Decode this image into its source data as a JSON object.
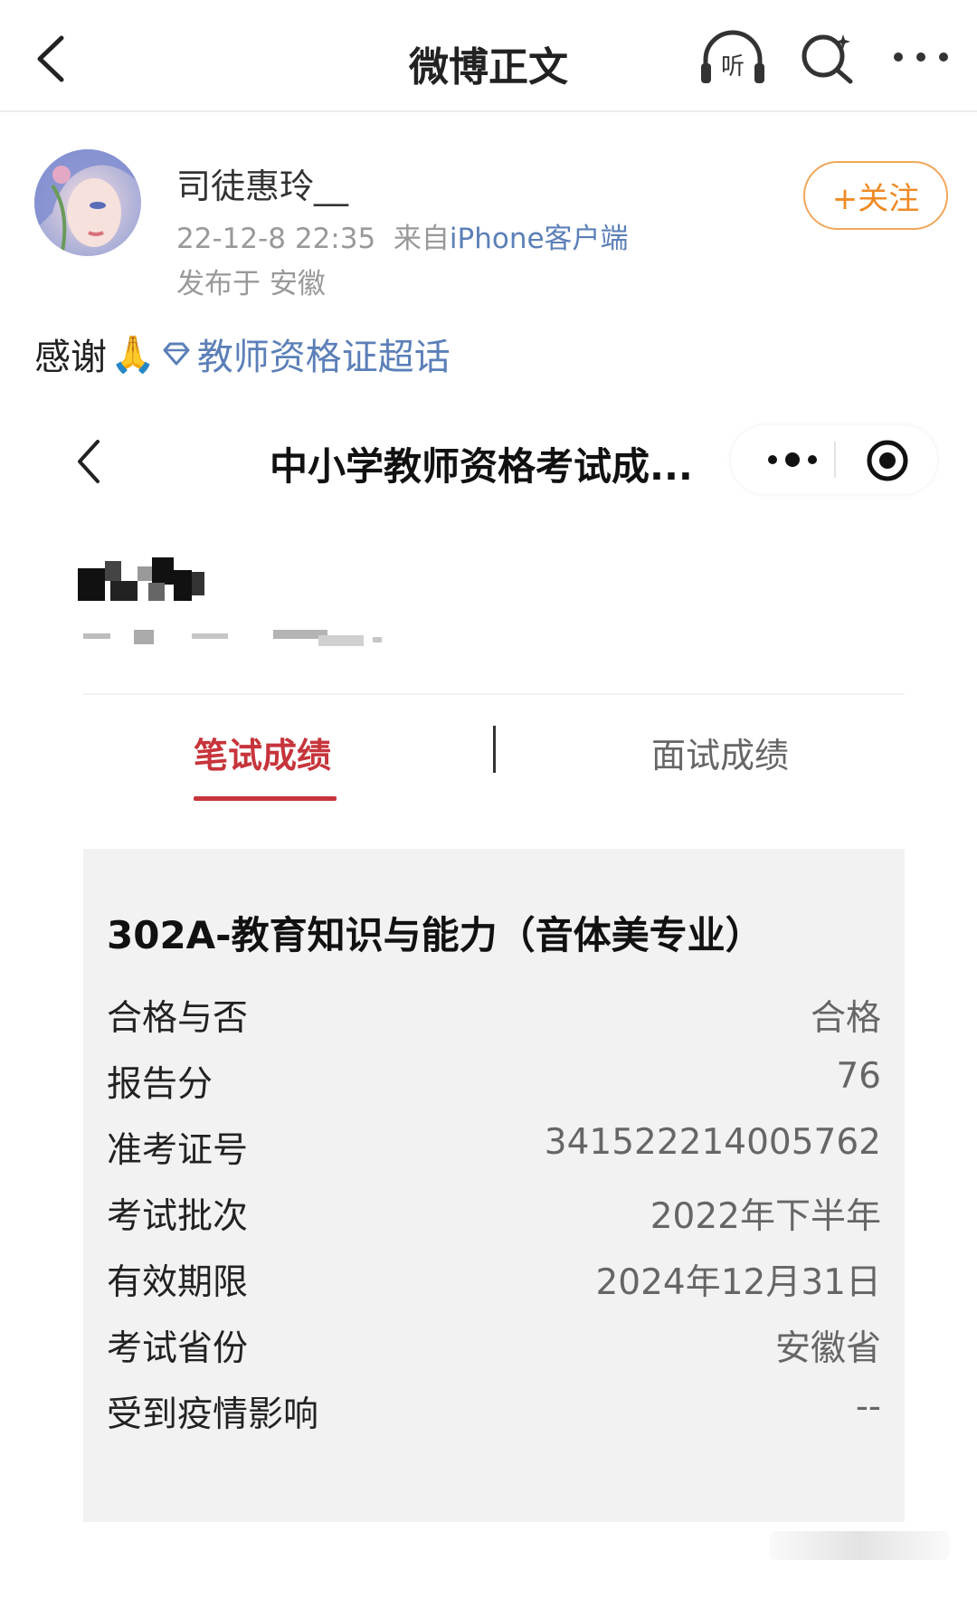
{
  "nav": {
    "title": "微博正文",
    "listen_icon": "listen-headphones-icon",
    "listen_label": "听",
    "search_icon": "search-icon",
    "more_icon": "more-icon"
  },
  "post": {
    "username": "司徒惠玲__",
    "time": "22-12-8 22:35",
    "source_prefix": "来自",
    "source": "iPhone客户端",
    "location": "发布于 安徽",
    "follow_label": "+关注",
    "text": "感谢",
    "emoji": "🙏",
    "topic": "教师资格证超话"
  },
  "embedded": {
    "title": "中小学教师资格考试成...",
    "tabs": [
      {
        "label": "笔试成绩",
        "active": true
      },
      {
        "label": "面试成绩",
        "active": false
      }
    ],
    "card": {
      "title": "302A-教育知识与能力（音体美专业）",
      "rows": [
        {
          "label": "合格与否",
          "value": "合格"
        },
        {
          "label": "报告分",
          "value": "76"
        },
        {
          "label": "准考证号",
          "value": "341522214005762"
        },
        {
          "label": "考试批次",
          "value": "2022年下半年"
        },
        {
          "label": "有效期限",
          "value": "2024年12月31日"
        },
        {
          "label": "考试省份",
          "value": "安徽省"
        },
        {
          "label": "受到疫情影响",
          "value": "--"
        }
      ]
    }
  },
  "colors": {
    "accent_red": "#c7343b",
    "follow_orange": "#f08a24",
    "link_blue": "#5b7fb8"
  }
}
